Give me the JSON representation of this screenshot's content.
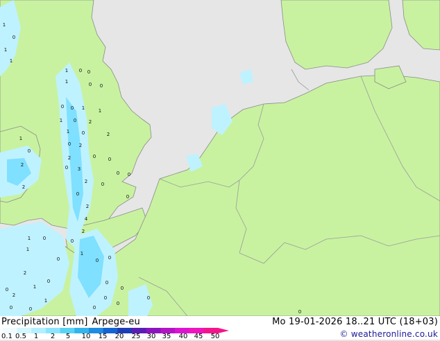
{
  "map": {
    "colors": {
      "sea": "#e6e6e6",
      "land": "#c8f2a0",
      "border": "#9a9a9a",
      "coast": "#8a8a8a",
      "precip_light": "#bff2ff",
      "precip_mid": "#7fe0ff",
      "precip_heavy": "#39c8f0"
    },
    "precip_labels": [
      "1",
      "0",
      "1",
      "1",
      "1",
      "0",
      "0",
      "1",
      "0",
      "0",
      "0",
      "0",
      "1",
      "1",
      "1",
      "0",
      "2",
      "1",
      "0",
      "2",
      "0",
      "2",
      "1",
      "0",
      "2",
      "0",
      "0",
      "3",
      "0",
      "2",
      "0",
      "0",
      "2",
      "2",
      "0",
      "0",
      "0",
      "2",
      "4",
      "2",
      "0",
      "1",
      "1",
      "0",
      "1",
      "0",
      "0",
      "0",
      "2",
      "0",
      "1",
      "2",
      "1",
      "0",
      "0",
      "0",
      "0",
      "0",
      "0",
      "0",
      "0",
      "0",
      "0"
    ]
  },
  "footer": {
    "title": "Precipitation [mm]",
    "model": "Arpege-eu",
    "datetime": "Mo 19-01-2026 18..21 UTC (18+03)",
    "credit": "© weatheronline.co.uk"
  },
  "legend": {
    "ticks": [
      "0.1",
      "0.5",
      "1",
      "2",
      "5",
      "10",
      "15",
      "20",
      "25",
      "30",
      "35",
      "40",
      "45",
      "50"
    ],
    "colors": [
      "#f0fcff",
      "#d2f7ff",
      "#b4f0ff",
      "#8ce4ff",
      "#5ad2f5",
      "#33b4ec",
      "#1e8ce1",
      "#1464d2",
      "#1e3cb4",
      "#5a1eb4",
      "#8c14be",
      "#b414c8",
      "#dc14d2",
      "#f014be",
      "#f5148c"
    ]
  }
}
